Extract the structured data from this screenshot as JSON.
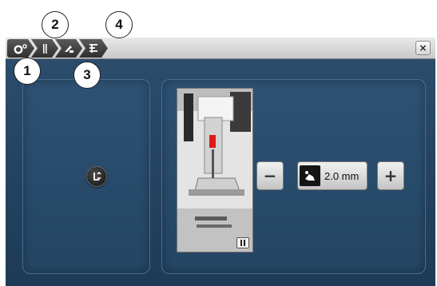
{
  "callouts": [
    "1",
    "2",
    "3",
    "4"
  ],
  "breadcrumb": [
    {
      "icon": "settings-icon"
    },
    {
      "icon": "sewing-bar-icon"
    },
    {
      "icon": "presser-foot-icon"
    },
    {
      "icon": "foot-pressure-icon"
    }
  ],
  "window": {
    "close_label": "×"
  },
  "left_panel": {
    "icon": "presser-foot-height-icon"
  },
  "right_panel": {
    "image": "presser-foot-photo",
    "pause_icon": "pause-icon",
    "minus_label": "−",
    "plus_label": "+",
    "value": "2.0 mm",
    "value_icon": "hand-foot-icon"
  },
  "colors": {
    "background": "#1e3a55",
    "panel": "#2e5274",
    "titlebar": "#d6d6d6"
  }
}
